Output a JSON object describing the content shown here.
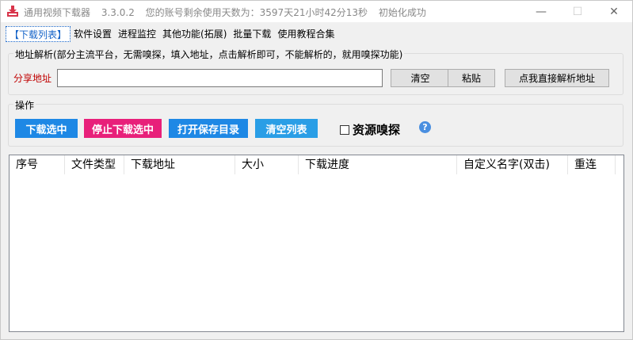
{
  "window": {
    "title": "通用视频下载器",
    "version": "3.3.0.2",
    "account_days": "您的账号剩余使用天数为：3597天21小时42分13秒",
    "status": "初始化成功",
    "minimize": "—",
    "maximize": "☐",
    "close": "✕"
  },
  "tabs": [
    {
      "label": "【下载列表】"
    },
    {
      "label": "软件设置"
    },
    {
      "label": "进程监控"
    },
    {
      "label": "其他功能(拓展)"
    },
    {
      "label": "批量下载"
    },
    {
      "label": "使用教程合集"
    }
  ],
  "parse_group": {
    "legend": "地址解析(部分主流平台，无需嗅探，填入地址，点击解析即可，不能解析的，就用嗅探功能)",
    "share_label": "分享地址",
    "url_value": "",
    "clear_button": "清空",
    "paste_button": "粘贴",
    "parse_button": "点我直接解析地址"
  },
  "ops_group": {
    "legend": "操作",
    "download_selected": "下载选中",
    "stop_selected": "停止下载选中",
    "open_folder": "打开保存目录",
    "clear_list": "清空列表",
    "sniff_label": "资源嗅探",
    "sniff_checked": false,
    "help": "?"
  },
  "colors": {
    "blue_button": "#1e88e5",
    "pink_button": "#e8207a",
    "light_blue_button": "#2a9ee6",
    "active_tab": "#1463c8",
    "share_label": "#c00000"
  },
  "list": {
    "columns": [
      "序号",
      "文件类型",
      "下载地址",
      "大小",
      "下载进度",
      "自定义名字(双击)",
      "重连"
    ],
    "rows": []
  }
}
